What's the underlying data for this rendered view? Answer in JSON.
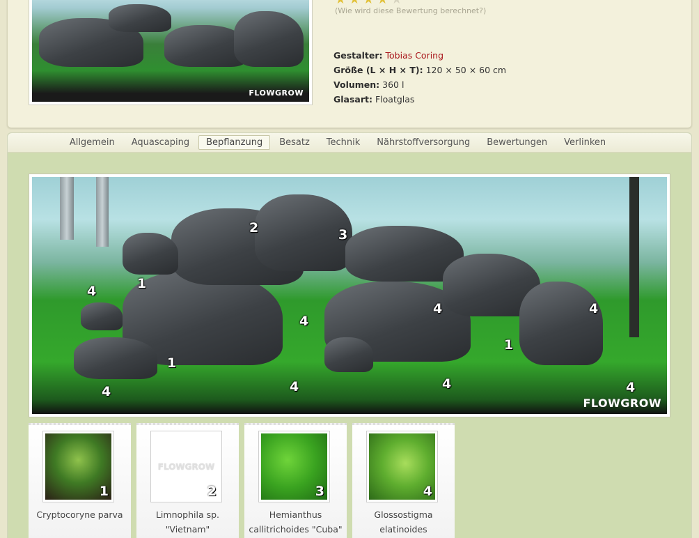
{
  "rating": {
    "link_text": "(Wie wird diese Bewertung berechnet?)",
    "stars_filled": 3.5,
    "stars_total": 5
  },
  "facts": {
    "designer_label": "Gestalter:",
    "designer_value": "Tobias Coring",
    "size_label": "Größe (L × H × T):",
    "size_value": "120 × 50 × 60 cm",
    "volume_label": "Volumen:",
    "volume_value": "360 l",
    "glass_label": "Glasart:",
    "glass_value": "Floatglas"
  },
  "tabs": [
    {
      "label": "Allgemein",
      "active": false
    },
    {
      "label": "Aquascaping",
      "active": false
    },
    {
      "label": "Bepflanzung",
      "active": true
    },
    {
      "label": "Besatz",
      "active": false
    },
    {
      "label": "Technik",
      "active": false
    },
    {
      "label": "Nährstoffversorgung",
      "active": false
    },
    {
      "label": "Bewertungen",
      "active": false
    },
    {
      "label": "Verlinken",
      "active": false
    }
  ],
  "photo": {
    "watermark": "FLOWGROW",
    "markers": [
      "2",
      "3",
      "1",
      "4",
      "4",
      "4",
      "4",
      "1",
      "1",
      "4",
      "4",
      "4",
      "4"
    ]
  },
  "plants": [
    {
      "number": "1",
      "name_line1": "Cryptocoryne parva",
      "name_line2": ""
    },
    {
      "number": "2",
      "name_line1": "Limnophila sp.",
      "name_line2": "\"Vietnam\""
    },
    {
      "number": "3",
      "name_line1": "Hemianthus",
      "name_line2": "callitrichoides \"Cuba\""
    },
    {
      "number": "4",
      "name_line1": "Glossostigma",
      "name_line2": "elatinoides"
    }
  ],
  "placeholder_watermark": "FLOWGROW",
  "colors": {
    "accent_red": "#a8141a",
    "panel_green": "#cfdcb0",
    "star_gold": "#e2c23a"
  }
}
